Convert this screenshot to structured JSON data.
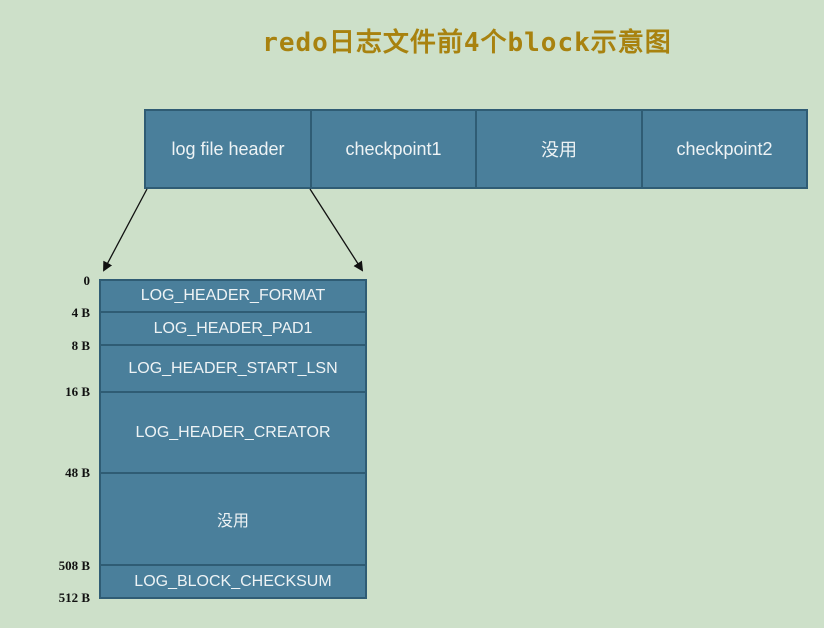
{
  "title": "redo日志文件前4个block示意图",
  "top_row": {
    "cells": [
      "log file header",
      "checkpoint1",
      "没用",
      "checkpoint2"
    ]
  },
  "block": {
    "fields": [
      "LOG_HEADER_FORMAT",
      "LOG_HEADER_PAD1",
      "LOG_HEADER_START_LSN",
      "LOG_HEADER_CREATOR",
      "没用",
      "LOG_BLOCK_CHECKSUM"
    ],
    "offsets": [
      "0",
      "4 B",
      "8 B",
      "16 B",
      "48 B",
      "508 B",
      "512 B"
    ]
  },
  "colors": {
    "background": "#cde0c9",
    "cell_fill": "#4a7f9b",
    "cell_border": "#2f5c74",
    "title": "#a8820f"
  }
}
